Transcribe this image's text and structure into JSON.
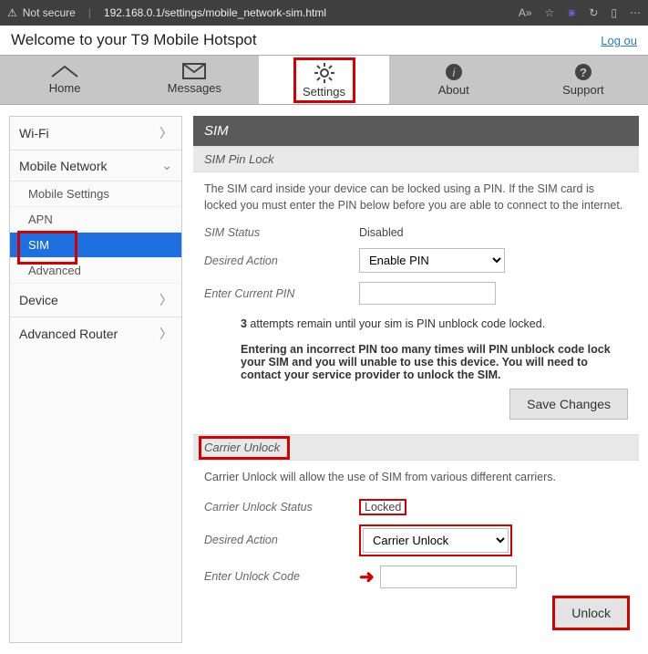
{
  "browser": {
    "not_secure": "Not secure",
    "url": "192.168.0.1/settings/mobile_network-sim.html",
    "icons": {
      "aa": "A»",
      "star": "☆",
      "ext": "⋇",
      "refresh": "↻",
      "panel": "▯",
      "more": "⋯"
    }
  },
  "header": {
    "welcome": "Welcome to your T9 Mobile Hotspot",
    "logout": "Log ou"
  },
  "tabs": {
    "home": "Home",
    "messages": "Messages",
    "settings": "Settings",
    "about": "About",
    "support": "Support"
  },
  "sidebar": {
    "wifi": "Wi-Fi",
    "mobile_network": "Mobile Network",
    "mobile_settings": "Mobile Settings",
    "apn": "APN",
    "sim": "SIM",
    "advanced": "Advanced",
    "device": "Device",
    "advanced_router": "Advanced Router"
  },
  "panel": {
    "title": "SIM"
  },
  "pinlock": {
    "section": "SIM Pin Lock",
    "desc": "The SIM card inside your device can be locked using a PIN. If the SIM card is locked you must enter the PIN below before you are able to connect to the internet.",
    "status_label": "SIM Status",
    "status_value": "Disabled",
    "action_label": "Desired Action",
    "action_value": "Enable PIN",
    "pin_label": "Enter Current PIN",
    "attempts_prefix": "3",
    "attempts_text": " attempts remain until your sim is PIN unblock code locked.",
    "warning": "Entering an incorrect PIN too many times will PIN unblock code lock your SIM and you will unable to use this device. You will need to contact your service provider to unlock the SIM.",
    "save": "Save Changes"
  },
  "carrier": {
    "section": "Carrier Unlock",
    "desc": "Carrier Unlock will allow the use of SIM from various different carriers.",
    "status_label": "Carrier Unlock Status",
    "status_value": "Locked",
    "action_label": "Desired Action",
    "action_value": "Carrier Unlock",
    "code_label": "Enter Unlock Code",
    "unlock": "Unlock"
  }
}
